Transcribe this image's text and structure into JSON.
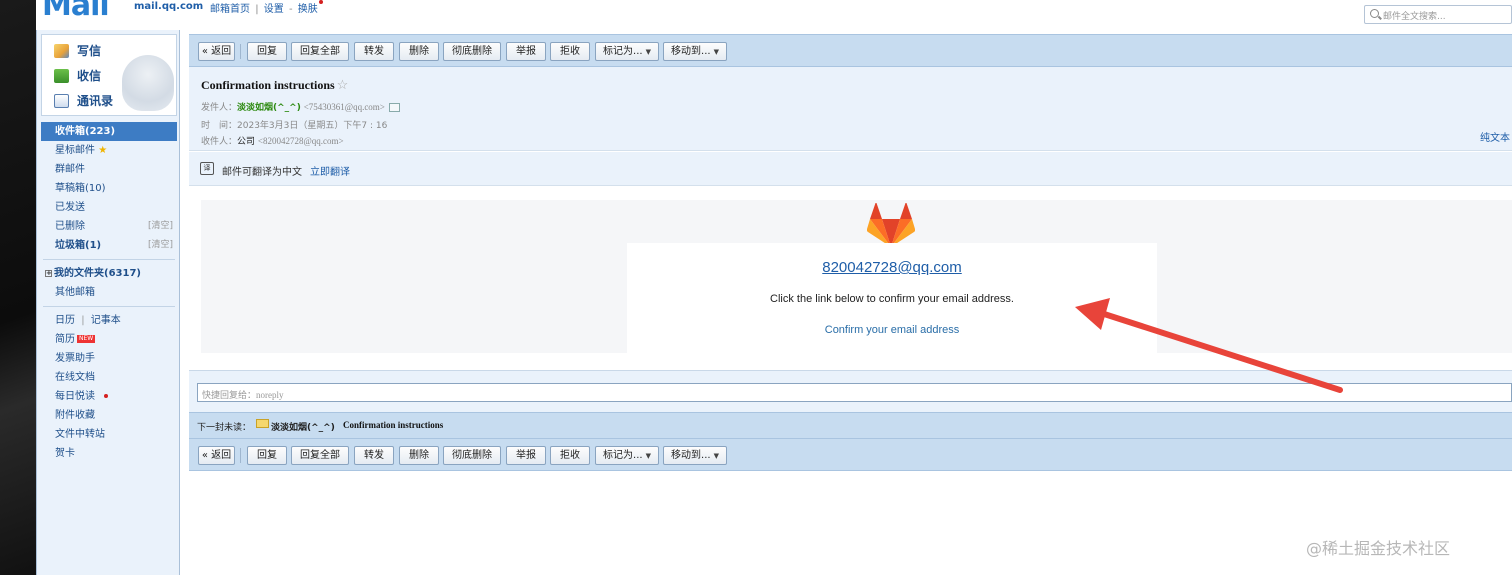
{
  "topbar": {
    "logo_text": "Mail",
    "logo_domain": "mail.qq.com",
    "nav_home": "邮箱首页",
    "nav_settings": "设置",
    "nav_skin": "换肤",
    "search_placeholder": "邮件全文搜索..."
  },
  "sidebar": {
    "quick": [
      {
        "label": "写信",
        "icon": "pencil-icon"
      },
      {
        "label": "收信",
        "icon": "inbox-download-icon"
      },
      {
        "label": "通讯录",
        "icon": "contacts-icon"
      }
    ],
    "folders": {
      "inbox": "收件箱(223)",
      "starred": "星标邮件",
      "group": "群邮件",
      "drafts": "草稿箱(10)",
      "sent": "已发送",
      "deleted": "已删除",
      "spam": "垃圾箱(1)",
      "clear": "[清空]",
      "my_folders": "我的文件夹(6317)",
      "other_mail": "其他邮箱"
    },
    "apps": {
      "calendar": "日历",
      "notes": "记事本",
      "resume": "简历",
      "new_badge": "NEW",
      "invoice": "发票助手",
      "docs": "在线文档",
      "daily": "每日悦读",
      "attachments": "附件收藏",
      "transfer": "文件中转站",
      "cards": "贺卡"
    }
  },
  "toolbar": {
    "back": "« 返回",
    "reply": "回复",
    "reply_all": "回复全部",
    "forward": "转发",
    "delete": "删除",
    "delete_perm": "彻底删除",
    "report": "举报",
    "reject": "拒收",
    "mark_as": "标记为...",
    "move_to": "移动到..."
  },
  "message": {
    "subject": "Confirmation instructions",
    "from_label": "发件人：",
    "from_name": "淡淡如烟(^_^)",
    "from_addr": "<75430361@qq.com>",
    "time_label": "时　间：",
    "time_value": "2023年3月3日（星期五）下午7 : 16",
    "to_label": "收件人：",
    "to_name": "公司",
    "to_addr": "<820042728@qq.com>",
    "plain_text": "纯文本"
  },
  "translate": {
    "icon_glyph": "译",
    "text": "邮件可翻译为中文",
    "link": "立即翻译"
  },
  "email_body": {
    "address": "820042728@qq.com",
    "instruction": "Click the link below to confirm your email address.",
    "confirm_link": "Confirm your email address"
  },
  "reply": {
    "placeholder": "快捷回复给：",
    "recipient": "noreply"
  },
  "next_unread": {
    "label": "下一封未读：",
    "sender": "淡淡如烟(^_^)",
    "subject": "Confirmation instructions"
  },
  "watermark": "@稀土掘金技术社区",
  "colors": {
    "toolbar_bg": "#c7dcf0",
    "panel_bg": "#eaf2fb",
    "link": "#1f5ea8",
    "sender_green": "#2e8b12",
    "arrow_red": "#e8443a",
    "gitlab_orange": "#e24329"
  }
}
